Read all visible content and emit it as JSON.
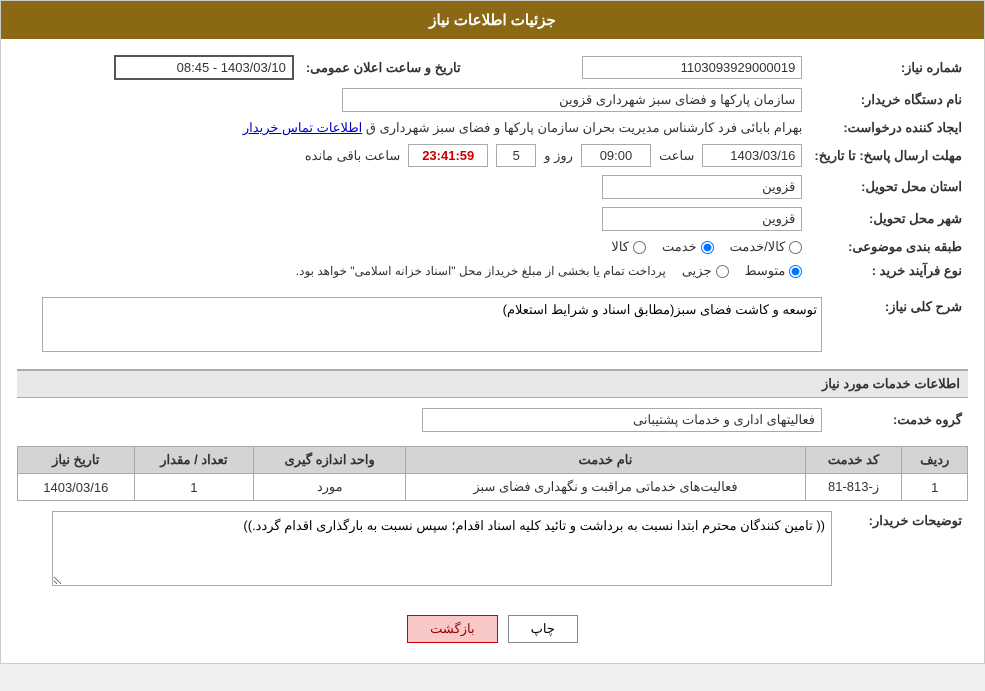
{
  "header": {
    "title": "جزئیات اطلاعات نیاز"
  },
  "fields": {
    "shomareNiaz_label": "شماره نیاز:",
    "shomareNiaz_value": "1103093929000019",
    "namDastgah_label": "نام دستگاه خریدار:",
    "namDastgah_value": "سازمان پارکها و فضای سبز شهرداری قزوین",
    "ijadKonande_label": "ایجاد کننده درخواست:",
    "ijadKonande_value": "بهرام بابائی فرد کارشناس مدیریت بحران سازمان پارکها و فضای سبز شهرداری ق",
    "ijadKonande_link": "اطلاعات تماس خریدار",
    "mohlatErsalLabel": "مهلت ارسال پاسخ: تا تاریخ:",
    "mohlatDate": "1403/03/16",
    "mohlatSaat": "09:00",
    "mohlatRoz": "5",
    "mohlatCountdown": "23:41:59",
    "mohlatBaqi": "ساعت باقی مانده",
    "mohlatRozLabel": "روز و",
    "mohlatSaatLabel": "ساعت",
    "ostanTahvil_label": "استان محل تحویل:",
    "ostanTahvil_value": "قزوین",
    "shahrTahvil_label": "شهر محل تحویل:",
    "shahrTahvil_value": "قزوین",
    "tabaqeBandi_label": "طبقه بندی موضوعی:",
    "tabaqeBandi_kala": "کالا",
    "tabaqeBandi_khadamat": "خدمت",
    "tabaqeBandi_kalaKhadamat": "کالا/خدمت",
    "tabaqeBandi_selected": "khadamat",
    "noeFarayand_label": "نوع فرآیند خرید :",
    "noeFarayand_jazee": "جزیی",
    "noeFarayand_motavasset": "متوسط",
    "noeFarayand_description": "پرداخت تمام یا بخشی از مبلغ خریداز محل \"اسناد خزانه اسلامی\" خواهد بود.",
    "noeFarayand_selected": "motavasset",
    "tarichElan_label": "تاریخ و ساعت اعلان عمومی:",
    "tarichElan_value": "1403/03/10 - 08:45"
  },
  "sharhKolli": {
    "label": "شرح کلی نیاز:",
    "value": "توسعه و کاشت فضای سبز(مطابق اسناد و شرایط استعلام)"
  },
  "khadamat": {
    "sectionTitle": "اطلاعات خدمات مورد نیاز",
    "groupeKhedmat_label": "گروه خدمت:",
    "groupeKhedmat_value": "فعالیتهای اداری و خدمات پشتیبانی",
    "table": {
      "columns": [
        "ردیف",
        "کد خدمت",
        "نام خدمت",
        "واحد اندازه گیری",
        "تعداد / مقدار",
        "تاریخ نیاز"
      ],
      "rows": [
        {
          "radif": "1",
          "kodKhedmat": "ز-813-81",
          "namKhedmat": "فعالیت‌های خدماتی مراقبت و نگهداری فضای سبز",
          "vahed": "مورد",
          "tedad": "1",
          "tarich": "1403/03/16"
        }
      ]
    }
  },
  "tosifKharidar": {
    "label": "توضیحات خریدار:",
    "value": "(( تامین کنندگان محترم ابتدا نسبت به برداشت و تائید کلیه اسناد اقدام؛ سپس نسبت به بارگذاری اقدام گردد.))"
  },
  "buttons": {
    "print": "چاپ",
    "back": "بازگشت"
  }
}
